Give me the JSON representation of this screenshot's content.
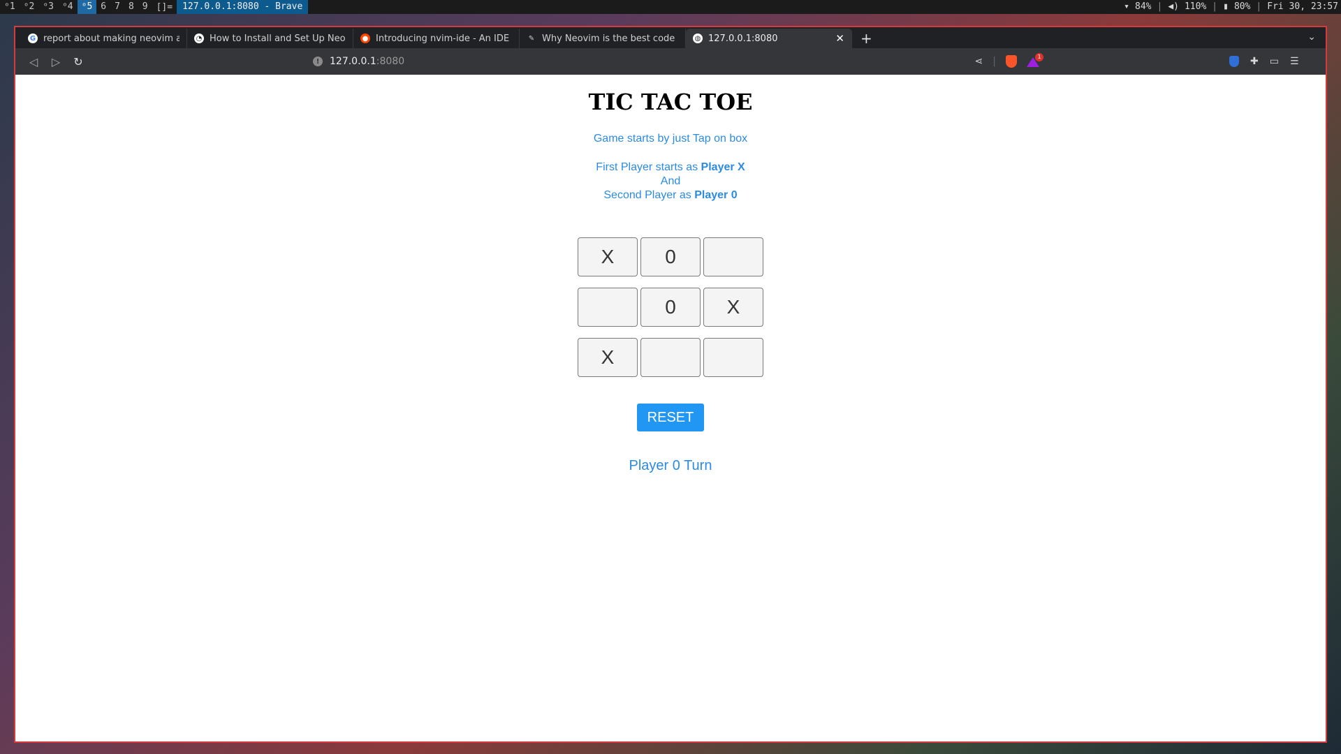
{
  "wm": {
    "workspaces": [
      "1",
      "2",
      "3",
      "4",
      "5",
      "6",
      "7",
      "8",
      "9"
    ],
    "active_workspace": "5",
    "layout": "[]=",
    "window_title": "127.0.0.1:8080 - Brave",
    "wifi": "84%",
    "volume": "110%",
    "battery": "80%",
    "clock": "Fri 30, 23:57"
  },
  "tabs": [
    {
      "label": "report about making neovim a",
      "favicon": "google-icon",
      "color": "#ffffff"
    },
    {
      "label": "How to Install and Set Up Neov",
      "favicon": "clock-site-icon",
      "color": "#ffffff"
    },
    {
      "label": "Introducing nvim-ide - An IDE l",
      "favicon": "reddit-icon",
      "color": "#ff4500"
    },
    {
      "label": "Why Neovim is the best code e",
      "favicon": "pencil-site-icon",
      "color": "#cccccc"
    },
    {
      "label": "127.0.0.1:8080",
      "favicon": "globe-icon",
      "color": "#ffffff",
      "active": true
    }
  ],
  "address": {
    "host": "127.0.0.1",
    "port": ":8080"
  },
  "rewards_badge": "1",
  "game": {
    "title": "TIC TAC TOE",
    "info_line1": "Game starts by just Tap on box",
    "info_first_prefix": "First Player starts as ",
    "info_first_bold": "Player X",
    "info_and": "And",
    "info_second_prefix": "Second Player as ",
    "info_second_bold": "Player 0",
    "board": [
      "X",
      "0",
      "",
      "",
      "0",
      "X",
      "X",
      "",
      ""
    ],
    "reset_label": "RESET",
    "turn_text": "Player 0 Turn"
  }
}
